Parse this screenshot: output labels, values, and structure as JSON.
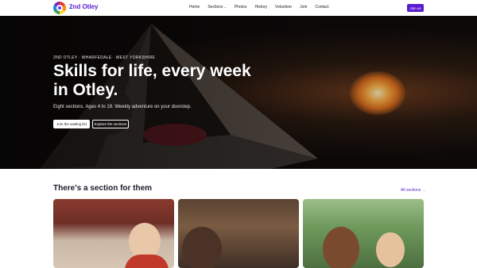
{
  "header": {
    "brand": "2nd Otley",
    "nav": [
      {
        "label": "Home"
      },
      {
        "label": "Sections",
        "has_dropdown": true
      },
      {
        "label": "Photos"
      },
      {
        "label": "History"
      },
      {
        "label": "Volunteer"
      },
      {
        "label": "Join"
      },
      {
        "label": "Contact"
      }
    ],
    "join_button": "Join us"
  },
  "hero": {
    "eyebrow": "2ND OTLEY · WHARFEDALE · WEST YORKSHIRE",
    "title": "Skills for life, every week in Otley.",
    "subtitle": "Eight sections. Ages 4 to 18. Weekly adventure on your doorstep.",
    "primary_button": "Join the waiting list",
    "secondary_button": "Explore the sections"
  },
  "sections": {
    "title": "There's a section for them",
    "all_link": "All sections →"
  },
  "colors": {
    "brand": "#5a1bd1",
    "hero_bg": "#0b0a0a"
  }
}
